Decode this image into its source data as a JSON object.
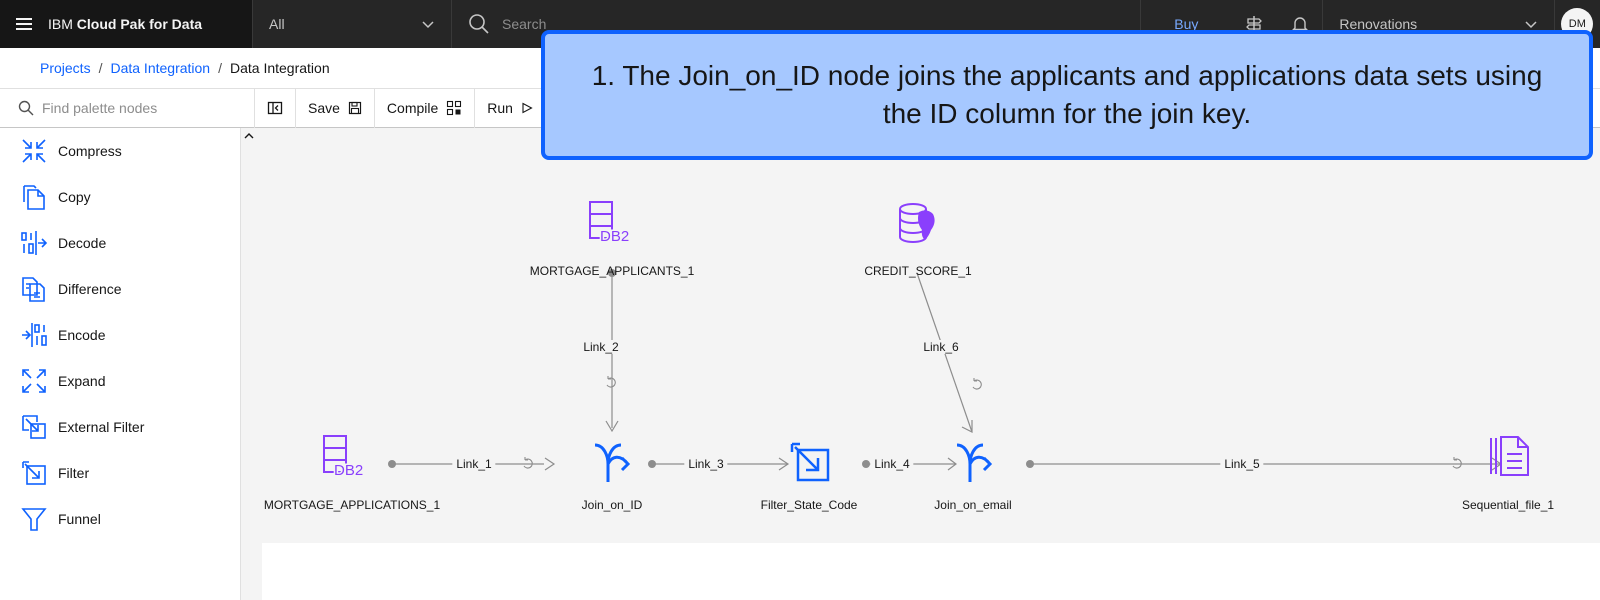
{
  "topbar": {
    "product_prefix": "IBM",
    "product_name": "Cloud Pak for Data",
    "scope": "All",
    "search_placeholder": "Search",
    "buy": "Buy",
    "account": "Renovations",
    "avatar": "DM"
  },
  "breadcrumb": {
    "items": [
      "Projects",
      "Data Integration",
      "Data Integration"
    ]
  },
  "toolbar": {
    "palette_search_placeholder": "Find palette nodes",
    "save": "Save",
    "compile": "Compile",
    "run": "Run"
  },
  "palette": {
    "items": [
      {
        "label": "Compress",
        "icon": "compress-icon"
      },
      {
        "label": "Copy",
        "icon": "copy-icon"
      },
      {
        "label": "Decode",
        "icon": "decode-icon"
      },
      {
        "label": "Difference",
        "icon": "difference-icon"
      },
      {
        "label": "Encode",
        "icon": "encode-icon"
      },
      {
        "label": "Expand",
        "icon": "expand-icon"
      },
      {
        "label": "External Filter",
        "icon": "external-filter-icon"
      },
      {
        "label": "Filter",
        "icon": "filter-icon"
      },
      {
        "label": "Funnel",
        "icon": "funnel-icon"
      }
    ]
  },
  "canvas": {
    "nodes": {
      "mortgage_applicants": "MORTGAGE_APPLICANTS_1",
      "credit_score": "CREDIT_SCORE_1",
      "mortgage_applications": "MORTGAGE_APPLICATIONS_1",
      "join_on_id": "Join_on_ID",
      "filter_state_code": "Filter_State_Code",
      "join_on_email": "Join_on_email",
      "sequential_file": "Sequential_file_1"
    },
    "links": {
      "link_1": "Link_1",
      "link_2": "Link_2",
      "link_3": "Link_3",
      "link_4": "Link_4",
      "link_5": "Link_5",
      "link_6": "Link_6"
    }
  },
  "callout": {
    "text": "1. The Join_on_ID node joins the applicants and applications data sets using the ID column for the join key."
  },
  "colors": {
    "db_purple": "#8a3ffc",
    "stage_blue": "#0f62fe",
    "callout_fill": "#a6c8ff",
    "callout_border": "#0f62fe"
  }
}
